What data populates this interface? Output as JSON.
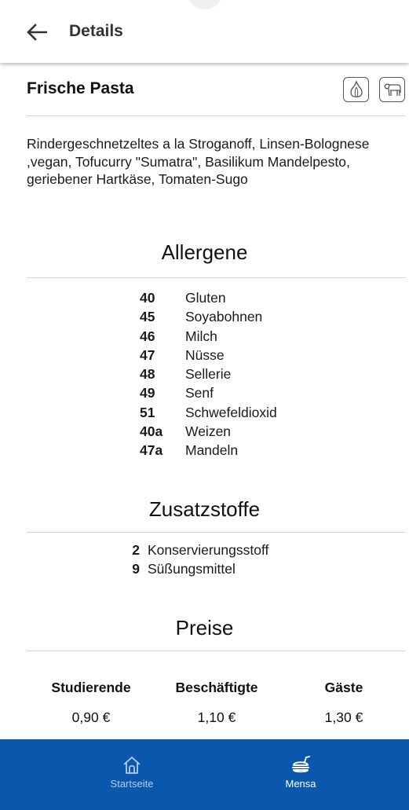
{
  "header": {
    "title": "Details",
    "back_icon": "arrow-left-icon"
  },
  "dish": {
    "title": "Frische Pasta",
    "icons": [
      "garlic-icon",
      "cow-icon"
    ],
    "description": "Rindergeschnetzeltes a la Stroganoff, Linsen-Bolognese ,vegan, Tofucurry \"Sumatra\", Basilikum Mandelpesto, geriebener Hartkäse, Tomaten-Sugo"
  },
  "allergens": {
    "title": "Allergene",
    "items": [
      {
        "code": "40",
        "name": "Gluten"
      },
      {
        "code": "45",
        "name": "Soyabohnen"
      },
      {
        "code": "46",
        "name": "Milch"
      },
      {
        "code": "47",
        "name": "Nüsse"
      },
      {
        "code": "48",
        "name": "Sellerie"
      },
      {
        "code": "49",
        "name": "Senf"
      },
      {
        "code": "51",
        "name": "Schwefeldioxid"
      },
      {
        "code": "40a",
        "name": "Weizen"
      },
      {
        "code": "47a",
        "name": "Mandeln"
      }
    ]
  },
  "additives": {
    "title": "Zusatzstoffe",
    "items": [
      {
        "code": "2",
        "name": "Konservierungsstoff"
      },
      {
        "code": "9",
        "name": "Süßungsmittel"
      }
    ]
  },
  "prices": {
    "title": "Preise",
    "columns": [
      {
        "label": "Studierende",
        "value": "0,90 €"
      },
      {
        "label": "Beschäftigte",
        "value": "1,10 €"
      },
      {
        "label": "Gäste",
        "value": "1,30 €"
      }
    ]
  },
  "nav": {
    "items": [
      {
        "label": "Startseite",
        "icon": "home-icon",
        "active": false
      },
      {
        "label": "Mensa",
        "icon": "burger-icon",
        "active": true
      }
    ]
  },
  "colors": {
    "nav_bar": "#0a58ad",
    "nav_inactive": "#b8cde6",
    "nav_active": "#ffffff"
  }
}
